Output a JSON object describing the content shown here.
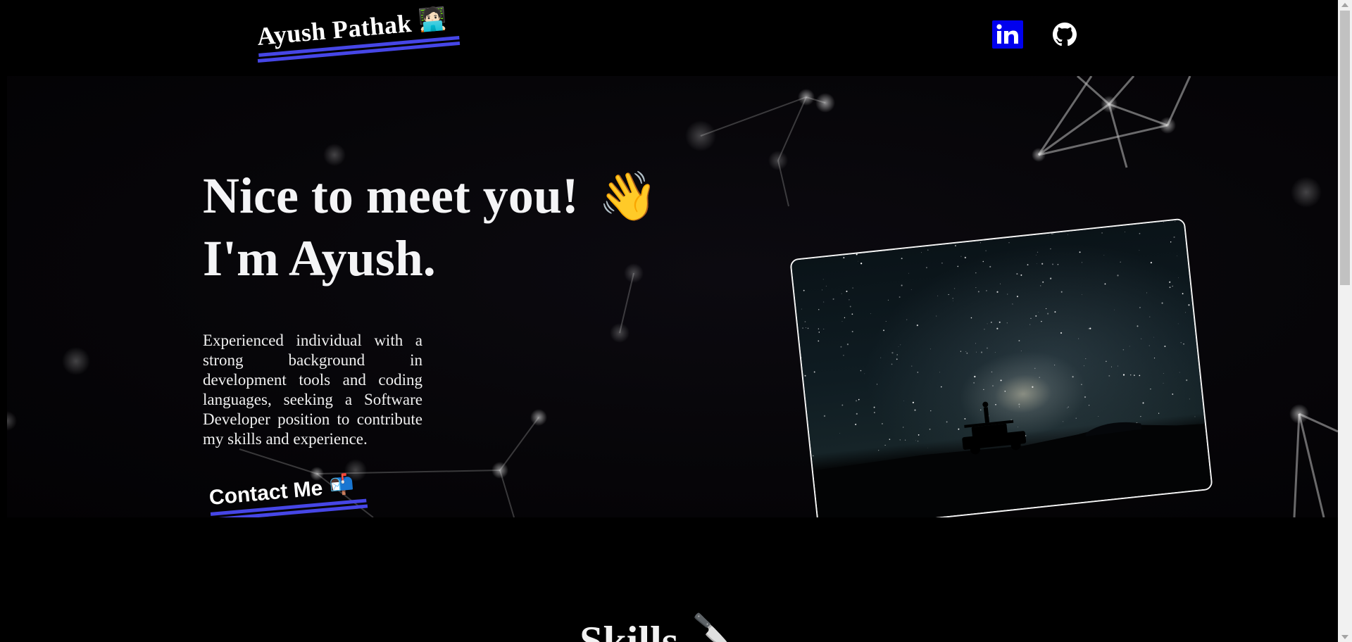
{
  "header": {
    "brand_name": "Ayush Pathak",
    "brand_emoji": "🧑🏻‍💻",
    "social": [
      {
        "name": "linkedin-icon",
        "label": "in"
      },
      {
        "name": "github-icon"
      }
    ]
  },
  "hero": {
    "headline_line1": "Nice to meet you!",
    "headline_emoji": "👋",
    "headline_line2": "I'm Ayush.",
    "bio": "Experienced individual with a strong background in development tools and coding languages, seeking a Software Developer position to contribute my skills and experience.",
    "contact_label": "Contact Me",
    "contact_emoji": "📬"
  },
  "skills": {
    "title": "Skills",
    "emoji": "🔪"
  },
  "colors": {
    "accent_underline": "#4646e6",
    "linkedin_bg": "#0000ee",
    "background": "#000000"
  }
}
